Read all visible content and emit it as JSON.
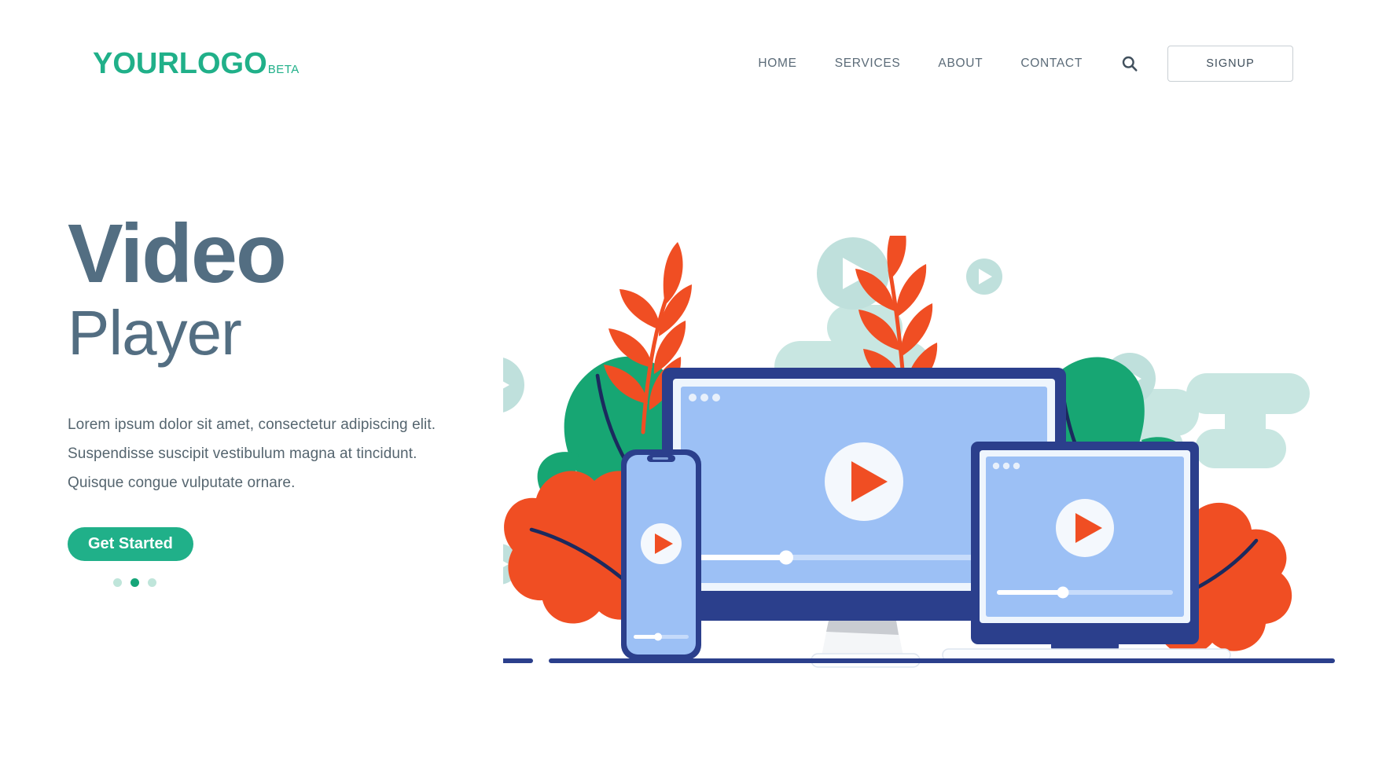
{
  "header": {
    "logo": {
      "main": "YOURLOGO",
      "beta": "BETA",
      "color": "#20b089"
    },
    "nav": [
      {
        "label": "HOME"
      },
      {
        "label": "SERVICES"
      },
      {
        "label": "ABOUT"
      },
      {
        "label": "CONTACT"
      }
    ],
    "search_icon": "search-icon",
    "signup_label": "SIGNUP"
  },
  "hero": {
    "title_line1": "Video",
    "title_line2": "Player",
    "title_color": "#536e82",
    "body": [
      "Lorem ipsum dolor sit amet, consectetur adipiscing elit.",
      "Suspendisse suscipit vestibulum magna at tincidunt.",
      "Quisque congue vulputate ornare."
    ],
    "cta_label": "Get Started",
    "cta_color": "#20b089",
    "carousel": {
      "count": 3,
      "active_index": 1,
      "active_color": "#15a578",
      "inactive_color": "#bfe5da"
    }
  },
  "illustration": {
    "name": "video-player-devices-illustration",
    "devices": [
      "desktop-monitor",
      "smartphone",
      "laptop"
    ],
    "play_icon_color": "#f04e23",
    "screen_color": "#9cc0f5",
    "bezel_color": "#2b3f8c",
    "colors": {
      "orange": "#f04e23",
      "green": "#17a673",
      "mint": "#bfe3de",
      "navy": "#25346e",
      "ground": "#2b3f8c"
    }
  }
}
